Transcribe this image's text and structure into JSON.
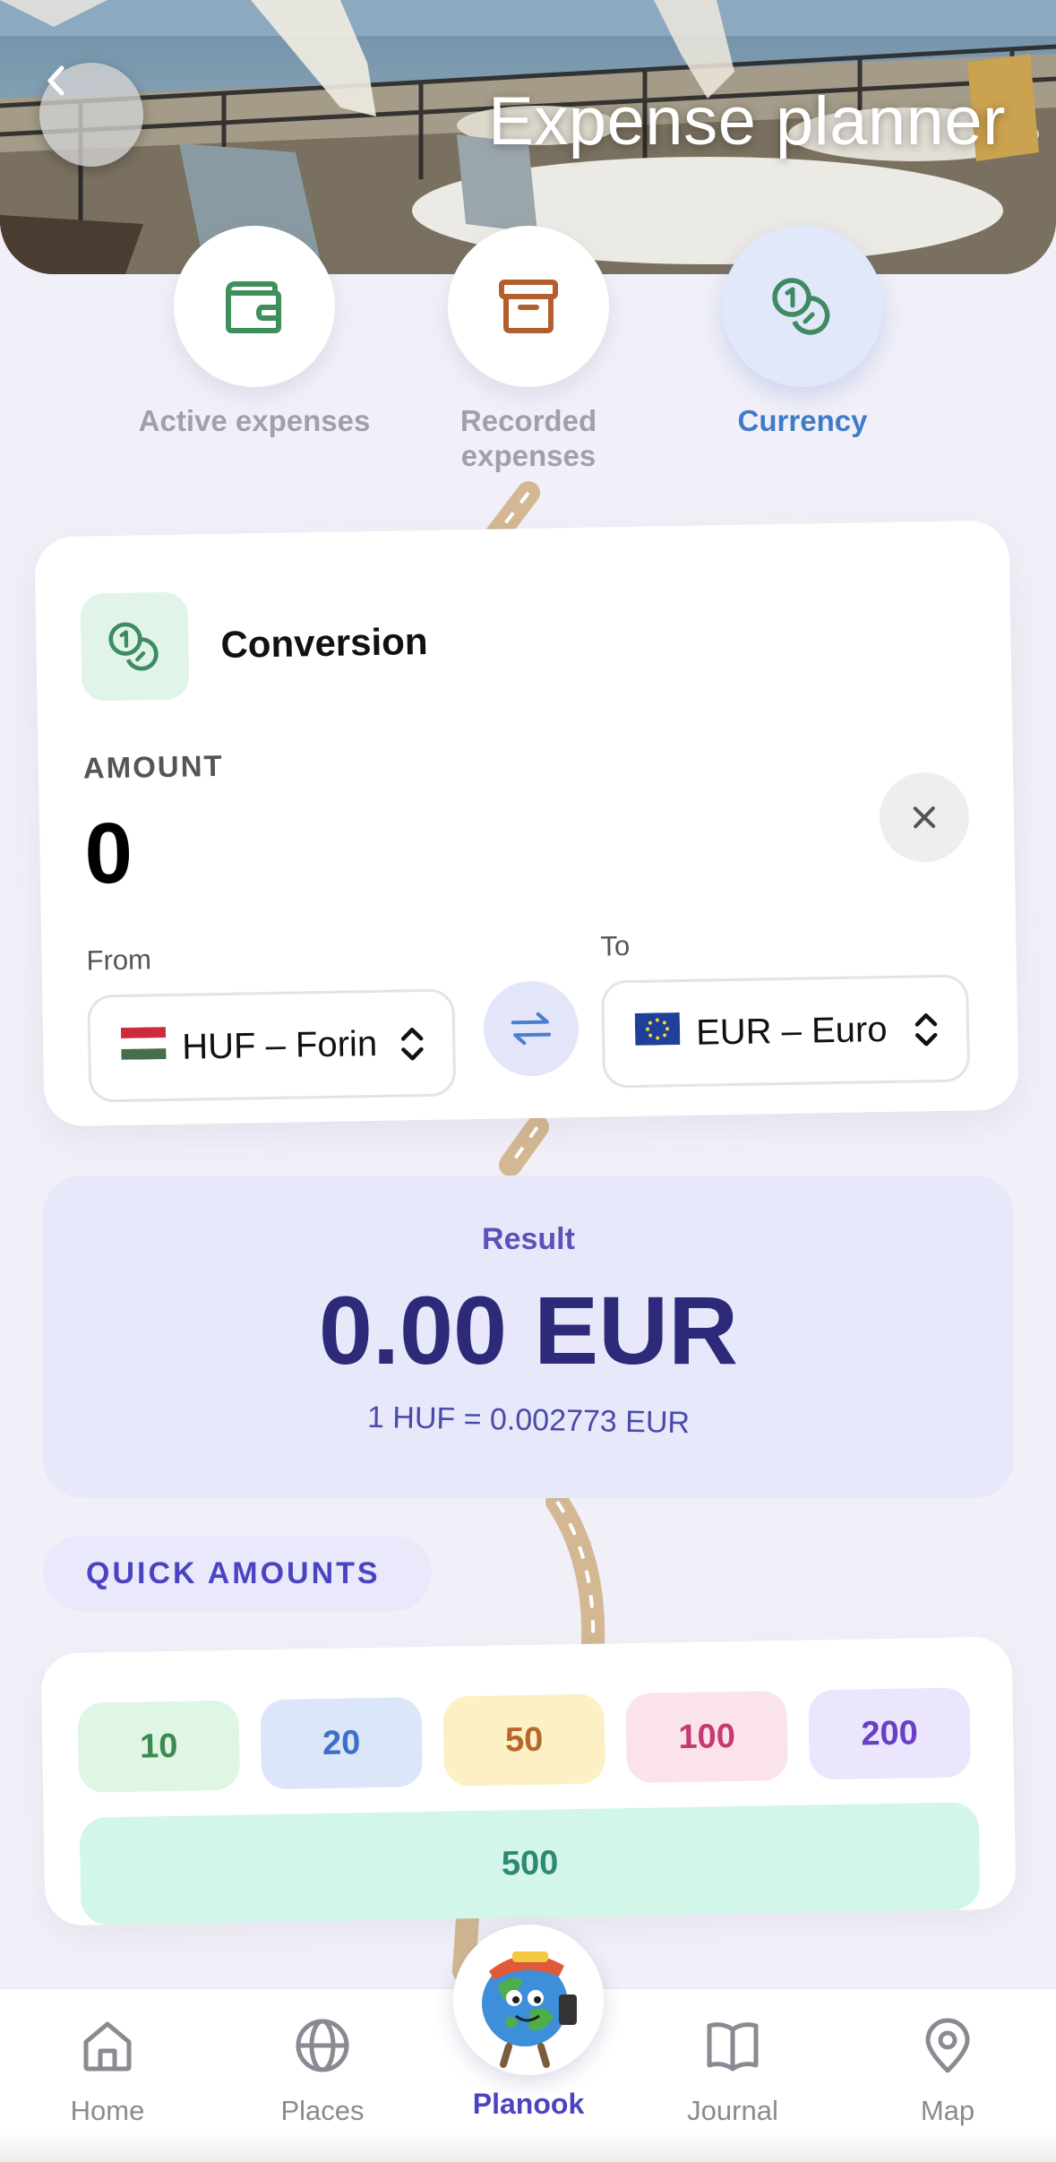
{
  "header": {
    "title": "Expense planner",
    "back_icon": "chevron-left-icon"
  },
  "modes": [
    {
      "label": "Active expenses",
      "icon": "wallet-icon",
      "color": "#3f8f5c",
      "active": false
    },
    {
      "label": "Recorded expenses",
      "icon": "archive-box-icon",
      "color": "#b35e2c",
      "active": false
    },
    {
      "label": "Currency",
      "icon": "coins-icon",
      "color": "#3e8a63",
      "active": true
    }
  ],
  "conversion": {
    "title": "Conversion",
    "amount_label": "AMOUNT",
    "amount_value": "0",
    "from_label": "From",
    "to_label": "To",
    "from_value": "HUF – Forin",
    "to_value": "EUR – Euro",
    "from_flag": "hungary-flag-icon",
    "to_flag": "eu-flag-icon"
  },
  "result": {
    "label": "Result",
    "value": "0.00 EUR",
    "rate": "1 HUF = 0.002773 EUR"
  },
  "quick_amounts": {
    "title": "QUICK AMOUNTS",
    "chips": [
      {
        "label": "10",
        "bg": "#dff6e4",
        "fg": "#3c8a52"
      },
      {
        "label": "20",
        "bg": "#dbe6f8",
        "fg": "#3e6fc6"
      },
      {
        "label": "50",
        "bg": "#fcf0c4",
        "fg": "#b6682a"
      },
      {
        "label": "100",
        "bg": "#fae3ea",
        "fg": "#c53a72"
      },
      {
        "label": "200",
        "bg": "#ebe6fb",
        "fg": "#6a3ec6"
      }
    ],
    "wide_chip": "500"
  },
  "nav": {
    "items": [
      {
        "label": "Home",
        "icon": "home-icon"
      },
      {
        "label": "Places",
        "icon": "globe-icon"
      },
      {
        "label": "Planook",
        "icon": "planook-mascot-avatar",
        "active": true
      },
      {
        "label": "Journal",
        "icon": "book-icon"
      },
      {
        "label": "Map",
        "icon": "map-pin-icon"
      }
    ]
  }
}
